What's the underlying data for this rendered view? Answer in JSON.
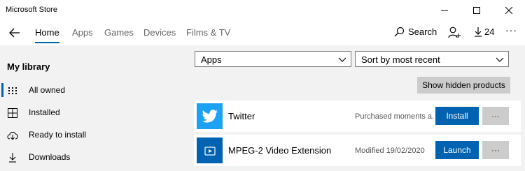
{
  "window": {
    "title": "Microsoft Store"
  },
  "nav": {
    "tabs": [
      {
        "label": "Home"
      },
      {
        "label": "Apps"
      },
      {
        "label": "Games"
      },
      {
        "label": "Devices"
      },
      {
        "label": "Films & TV"
      }
    ],
    "search_label": "Search",
    "downloads_count": "24"
  },
  "sidebar": {
    "heading": "My library",
    "items": [
      {
        "label": "All owned",
        "icon": "grid-icon",
        "selected": true
      },
      {
        "label": "Installed",
        "icon": "installed-icon"
      },
      {
        "label": "Ready to install",
        "icon": "cloud-icon"
      },
      {
        "label": "Downloads",
        "icon": "download-icon"
      }
    ]
  },
  "filters": {
    "category": "Apps",
    "sort": "Sort by most recent"
  },
  "hidden_button_label": "Show hidden products",
  "products": [
    {
      "name": "Twitter",
      "status": "Purchased moments a...",
      "action": "Install",
      "more": "···",
      "tile_color": "#1da1f2"
    },
    {
      "name": "MPEG-2 Video Extension",
      "status": "Modified 19/02/2020",
      "action": "Launch",
      "more": "···",
      "tile_color": "#0063b1"
    }
  ]
}
